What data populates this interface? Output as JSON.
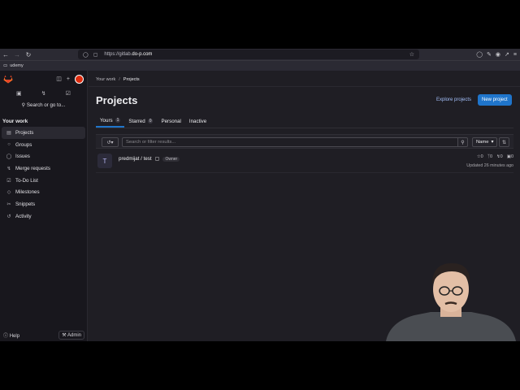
{
  "browser": {
    "url_prefix": "https://gitlab.",
    "url_host": "do-p.com",
    "bookmark": "udemy"
  },
  "sidebar": {
    "search_label": "Search or go to...",
    "section_title": "Your work",
    "items": [
      {
        "label": "Projects",
        "icon": "project-icon"
      },
      {
        "label": "Groups",
        "icon": "group-icon"
      },
      {
        "label": "Issues",
        "icon": "issues-icon"
      },
      {
        "label": "Merge requests",
        "icon": "merge-request-icon"
      },
      {
        "label": "To-Do List",
        "icon": "todo-icon"
      },
      {
        "label": "Milestones",
        "icon": "milestone-icon"
      },
      {
        "label": "Snippets",
        "icon": "snippet-icon"
      },
      {
        "label": "Activity",
        "icon": "activity-icon"
      }
    ],
    "help_label": "Help",
    "admin_label": "Admin"
  },
  "breadcrumb": {
    "root": "Your work",
    "current": "Projects"
  },
  "page": {
    "title": "Projects",
    "explore_label": "Explore projects",
    "new_label": "New project"
  },
  "tabs": [
    {
      "label": "Yours",
      "count": "1"
    },
    {
      "label": "Starred",
      "count": "0"
    },
    {
      "label": "Personal",
      "count": ""
    },
    {
      "label": "Inactive",
      "count": ""
    }
  ],
  "filter": {
    "placeholder": "Search or filter results...",
    "sort_label": "Name"
  },
  "projects": [
    {
      "avatar_letter": "T",
      "name": "predmijat / test",
      "role": "Owner",
      "stars": "0",
      "forks": "0",
      "merge_requests": "0",
      "issues": "0",
      "updated": "Updated 26 minutes ago"
    }
  ],
  "colors": {
    "accent": "#1f75cb",
    "sidebar_bg": "#18171d",
    "main_bg": "#1f1e24",
    "logo_orange": "#fc6d26"
  }
}
